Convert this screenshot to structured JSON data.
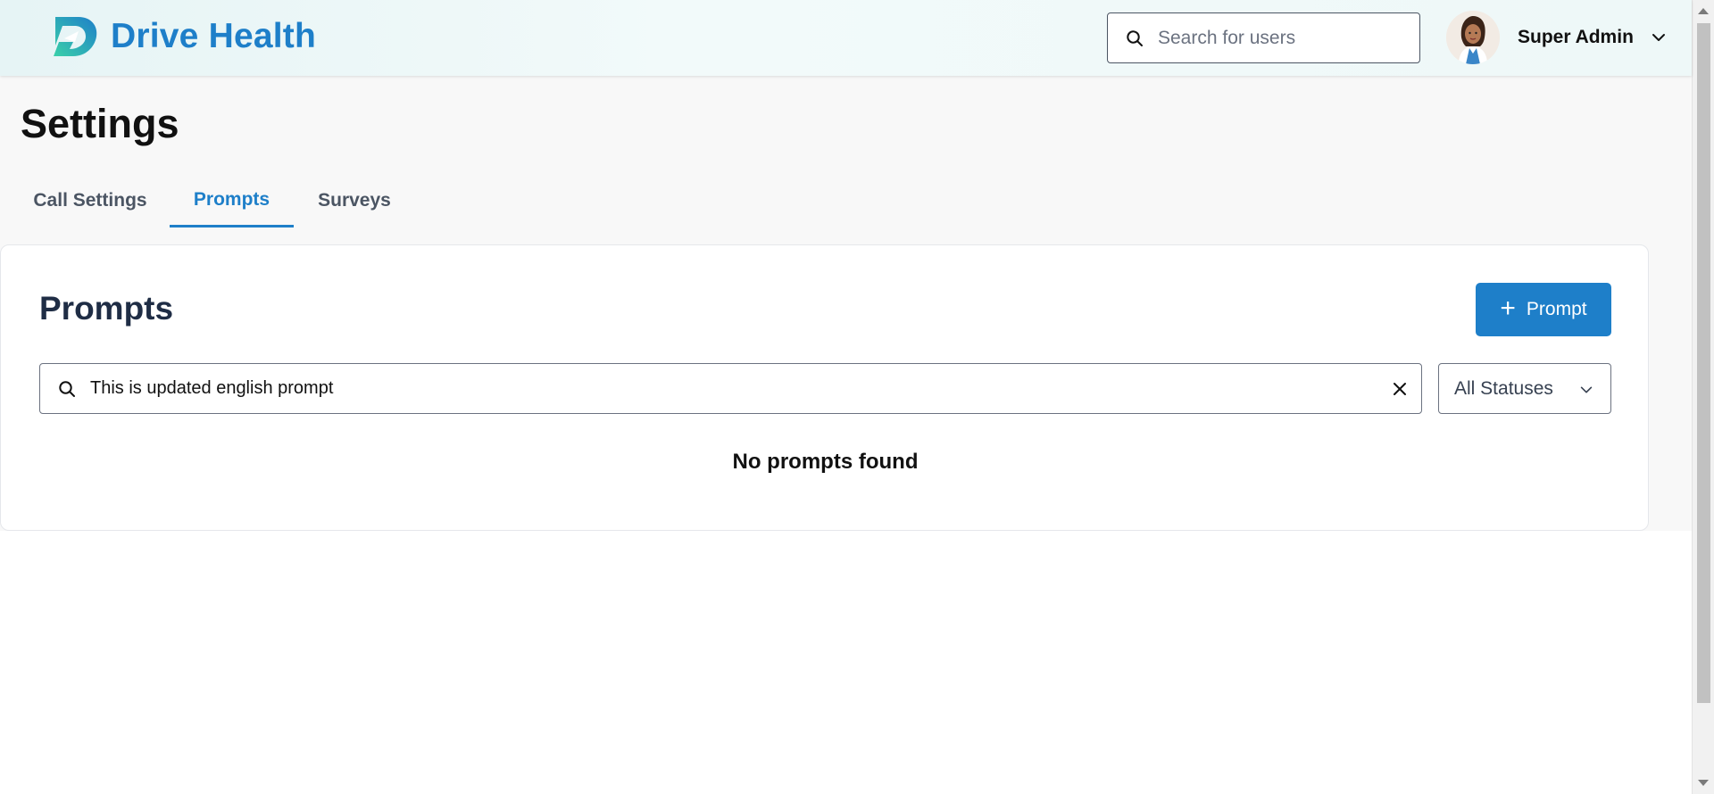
{
  "header": {
    "brand": "Drive Health",
    "user_search": {
      "placeholder": "Search for users",
      "value": ""
    },
    "user": {
      "name": "Super Admin"
    }
  },
  "page": {
    "title": "Settings",
    "tabs": [
      {
        "label": "Call Settings",
        "active": false
      },
      {
        "label": "Prompts",
        "active": true
      },
      {
        "label": "Surveys",
        "active": false
      }
    ]
  },
  "prompts": {
    "title": "Prompts",
    "add_button": {
      "icon": "+",
      "label": "Prompt"
    },
    "search": {
      "value": "This is updated english prompt",
      "placeholder": ""
    },
    "status_filter": {
      "selected": "All Statuses"
    },
    "empty_message": "No prompts found"
  },
  "colors": {
    "accent": "#1e7fc9",
    "brand_gradient_start": "#2ec4b6",
    "brand_gradient_end": "#1e7fc9"
  }
}
